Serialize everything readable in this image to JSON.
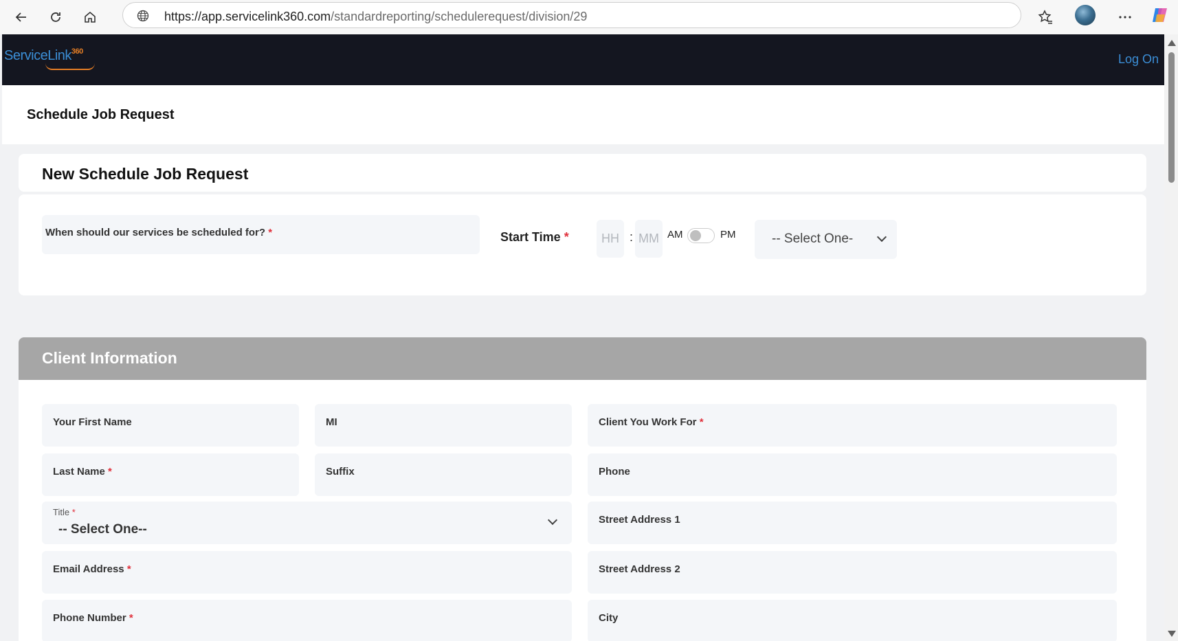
{
  "browser": {
    "url_host": "https://app.servicelink360.com",
    "url_path": "/standardreporting/schedulerequest/division/29"
  },
  "header": {
    "logo_text": "ServiceLink",
    "logo_sup": "360",
    "log_on": "Log On"
  },
  "page": {
    "title": "Schedule Job Request"
  },
  "request_card": {
    "title": "New Schedule Job Request",
    "date_label": "When should our services be scheduled for?",
    "start_time_label": "Start Time",
    "hh_placeholder": "HH",
    "mm_placeholder": "MM",
    "colon": ":",
    "am": "AM",
    "pm": "PM",
    "select_value": "-- Select One-"
  },
  "client_info": {
    "title": "Client Information",
    "first_name": "Your First Name",
    "mi": "MI",
    "client_you_work_for": "Client You Work For",
    "last_name": "Last Name",
    "suffix": "Suffix",
    "phone": "Phone",
    "title_label": "Title",
    "title_value": "-- Select One--",
    "street1": "Street Address 1",
    "email": "Email Address",
    "street2": "Street Address 2",
    "phone_number": "Phone Number",
    "city": "City"
  },
  "required_mark": "*"
}
